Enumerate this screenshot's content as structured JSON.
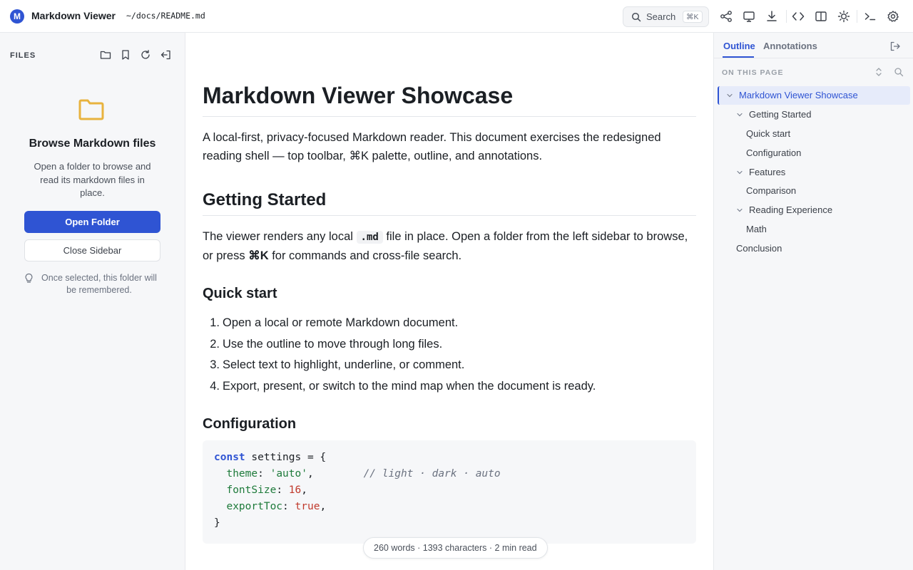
{
  "app": {
    "logo_letter": "M",
    "title": "Markdown Viewer",
    "file_path": "~/docs/README.md"
  },
  "toolbar": {
    "search_label": "Search",
    "search_shortcut": "⌘K",
    "icons": [
      "mindmap-icon",
      "present-icon",
      "download-icon",
      "code-icon",
      "columns-icon",
      "theme-icon",
      "terminal-icon",
      "settings-icon"
    ]
  },
  "sidebar": {
    "files_label": "FILES",
    "empty_title": "Browse Markdown files",
    "empty_desc": "Open a folder to browse and read its markdown files in place.",
    "open_folder_label": "Open Folder",
    "close_sidebar_label": "Close Sidebar",
    "hint": "Once selected, this folder will be remembered.",
    "accent_color": "#2f54d3",
    "folder_color": "#e8b33f"
  },
  "doc": {
    "h1": "Markdown Viewer Showcase",
    "intro": "A local-first, privacy-focused Markdown reader. This document exercises the redesigned reading shell — top toolbar, ⌘K palette, outline, and annotations.",
    "h2_getting_started": "Getting Started",
    "gs_part1": "The viewer renders any local ",
    "gs_code": ".md",
    "gs_part2": " file in place. Open a folder from the left sidebar to browse, or press ",
    "gs_kbd": "⌘K",
    "gs_part3": " for commands and cross-file search.",
    "h3_quick_start": "Quick start",
    "quick_start_items": [
      "Open a local or remote Markdown document.",
      "Use the outline to move through long files.",
      "Select text to highlight, underline, or comment.",
      "Export, present, or switch to the mind map when the document is ready."
    ],
    "h3_configuration": "Configuration",
    "code": {
      "kw_const": "const",
      "var_line": " settings = {",
      "k1": "theme",
      "v1": "'auto'",
      "c1": "// light · dark · auto",
      "k2": "fontSize",
      "v2": "16",
      "k3": "exportToc",
      "v3": "true",
      "close": "}"
    },
    "status": "260 words · 1393 characters · 2 min read"
  },
  "right_panel": {
    "tab_outline": "Outline",
    "tab_annotations": "Annotations",
    "on_this_page": "ON THIS PAGE",
    "outline": [
      {
        "label": "Markdown Viewer Showcase",
        "active": true
      },
      {
        "label": "Getting Started"
      },
      {
        "label": "Quick start"
      },
      {
        "label": "Configuration"
      },
      {
        "label": "Features"
      },
      {
        "label": "Comparison"
      },
      {
        "label": "Reading Experience"
      },
      {
        "label": "Math"
      },
      {
        "label": "Conclusion"
      }
    ]
  }
}
